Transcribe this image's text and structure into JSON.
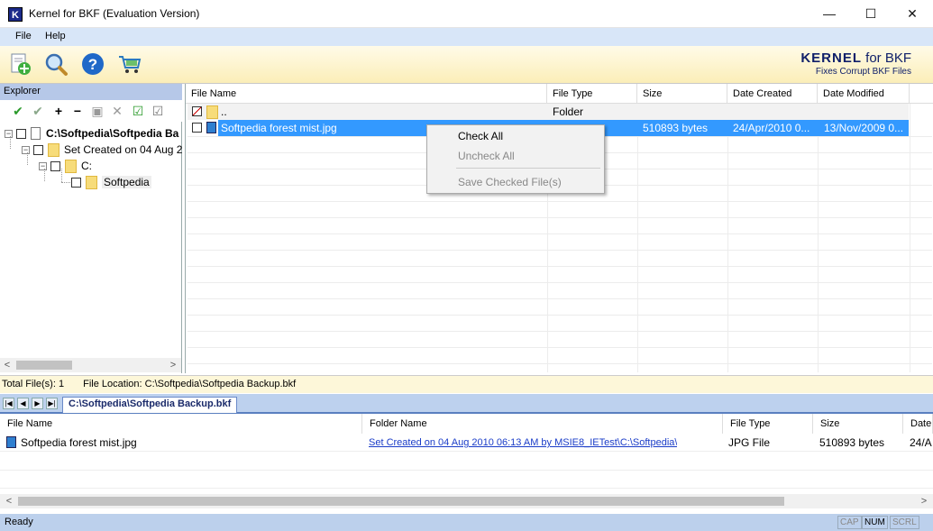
{
  "window": {
    "title": "Kernel for BKF (Evaluation Version)",
    "app_icon_letter": "K",
    "minimize": "—",
    "maximize": "☐",
    "close": "✕"
  },
  "menu": {
    "file": "File",
    "help": "Help"
  },
  "toolbar": {
    "icons": [
      "add-file-icon",
      "search-icon",
      "help-icon",
      "cart-icon"
    ],
    "help_glyph": "?"
  },
  "brand": {
    "main": "KERNEL",
    "for": " for BKF",
    "tagline": "Fixes Corrupt BKF Files"
  },
  "explorer": {
    "title": "Explorer",
    "tools": [
      "✔",
      "✔",
      "+",
      "−",
      "▣",
      "✕",
      "☑",
      "☑"
    ],
    "tree": [
      {
        "label": "C:\\Softpedia\\Softpedia Ba",
        "bold": true,
        "kind": "doc"
      },
      {
        "label": "Set Created on 04 Aug 2",
        "kind": "folder"
      },
      {
        "label": "C:",
        "kind": "folder"
      },
      {
        "label": "Softpedia",
        "kind": "folder"
      }
    ],
    "expander_glyph": "−"
  },
  "filelist": {
    "columns": [
      "File Name",
      "File Type",
      "Size",
      "Date Created",
      "Date Modified"
    ],
    "rows": [
      {
        "name": "..",
        "type": "Folder",
        "size": "",
        "created": "",
        "modified": ""
      },
      {
        "name": "Softpedia forest mist.jpg",
        "type": "",
        "size": "510893 bytes",
        "created": "24/Apr/2010 0...",
        "modified": "13/Nov/2009 0..."
      }
    ]
  },
  "context_menu": {
    "check_all": "Check All",
    "uncheck_all": "Uncheck All",
    "save_checked": "Save Checked File(s)"
  },
  "location_bar": {
    "total_files": "Total File(s): 1",
    "file_location": "File Location: C:\\Softpedia\\Softpedia Backup.bkf"
  },
  "tabs": {
    "nav": [
      "|◀",
      "◀",
      "▶",
      "▶|"
    ],
    "active": "C:\\Softpedia\\Softpedia Backup.bkf"
  },
  "bottom_list": {
    "columns": [
      "File Name",
      "Folder Name",
      "File Type",
      "Size",
      "Date"
    ],
    "rows": [
      {
        "name": "Softpedia forest mist.jpg",
        "folder": "Set Created on 04 Aug 2010 06:13 AM by MSIE8_IETest\\C:\\Softpedia\\",
        "type": "JPG File",
        "size": "510893 bytes",
        "date": "24/A"
      }
    ]
  },
  "scroll": {
    "left": "<",
    "right": ">"
  },
  "status": {
    "ready": "Ready",
    "cap": "CAP",
    "num": "NUM",
    "scrl": "SCRL"
  },
  "colors": {
    "selection": "#3399ff",
    "brand": "#10206a",
    "panel_head": "#b6c8e8"
  }
}
